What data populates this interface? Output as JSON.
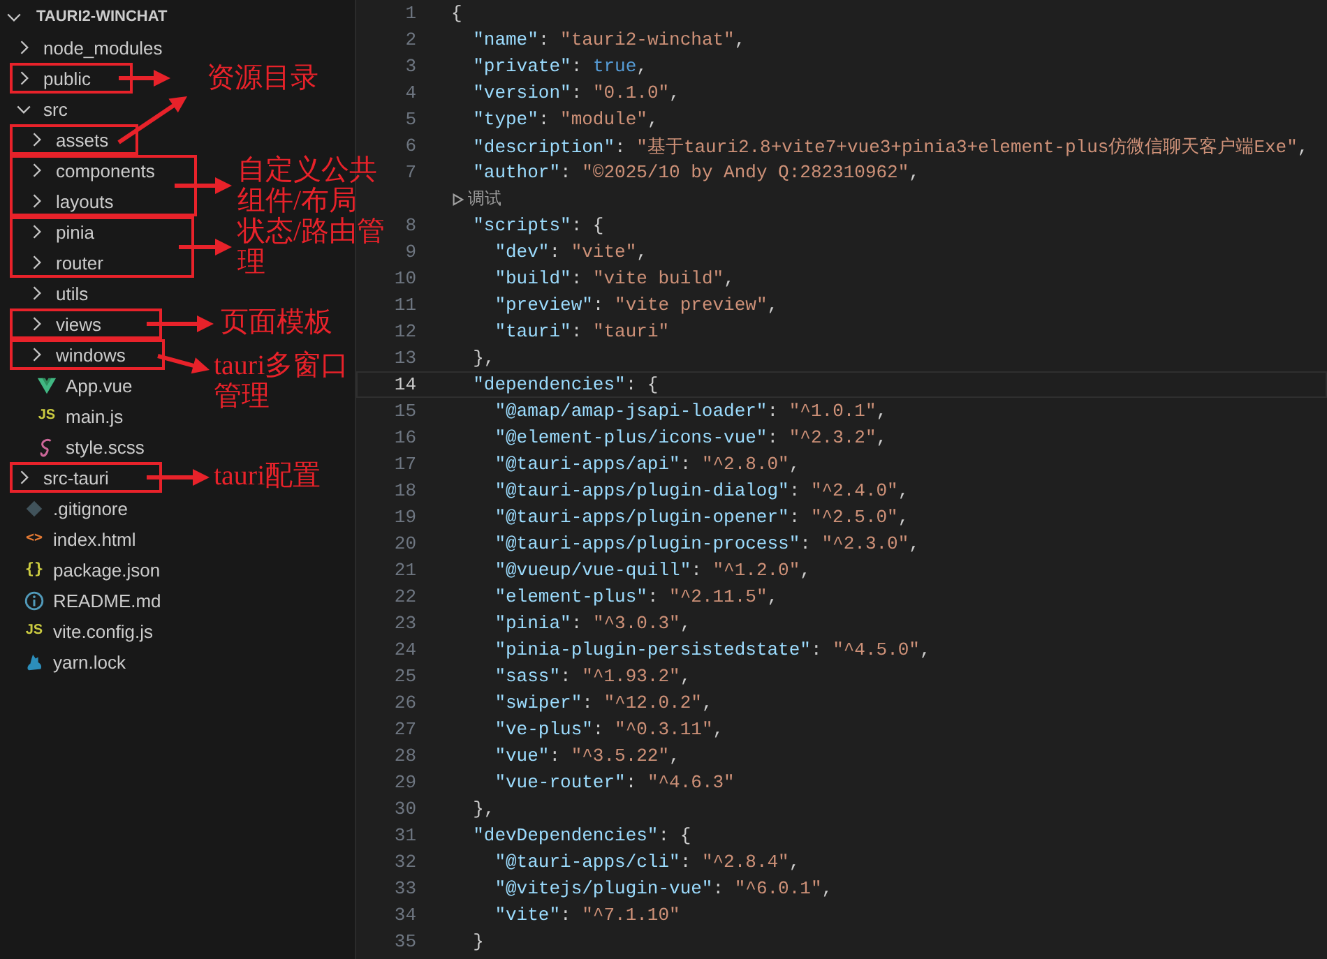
{
  "explorer": {
    "title": "TAURI2-WINCHAT",
    "expanded": true,
    "items": [
      {
        "label": "node_modules",
        "kind": "folder",
        "expanded": false
      },
      {
        "label": "public",
        "kind": "folder",
        "expanded": false
      },
      {
        "label": "src",
        "kind": "folder",
        "expanded": true,
        "children": [
          {
            "label": "assets",
            "kind": "folder",
            "expanded": false
          },
          {
            "label": "components",
            "kind": "folder",
            "expanded": false
          },
          {
            "label": "layouts",
            "kind": "folder",
            "expanded": false
          },
          {
            "label": "pinia",
            "kind": "folder",
            "expanded": false
          },
          {
            "label": "router",
            "kind": "folder",
            "expanded": false
          },
          {
            "label": "utils",
            "kind": "folder",
            "expanded": false
          },
          {
            "label": "views",
            "kind": "folder",
            "expanded": false
          },
          {
            "label": "windows",
            "kind": "folder",
            "expanded": false
          },
          {
            "label": "App.vue",
            "kind": "vue"
          },
          {
            "label": "main.js",
            "kind": "js",
            "glyph": "JS"
          },
          {
            "label": "style.scss",
            "kind": "scss"
          }
        ]
      },
      {
        "label": "src-tauri",
        "kind": "folder",
        "expanded": false
      },
      {
        "label": ".gitignore",
        "kind": "git"
      },
      {
        "label": "index.html",
        "kind": "html",
        "glyph": "<>"
      },
      {
        "label": "package.json",
        "kind": "json",
        "glyph": "{}"
      },
      {
        "label": "README.md",
        "kind": "info"
      },
      {
        "label": "vite.config.js",
        "kind": "js",
        "glyph": "JS"
      },
      {
        "label": "yarn.lock",
        "kind": "yarn"
      }
    ]
  },
  "editor": {
    "lines": [
      {
        "kind": "code",
        "number": "1",
        "selected": false,
        "tokens": [
          {
            "kind": "punct",
            "text": "{"
          }
        ]
      },
      {
        "kind": "code",
        "number": "2",
        "selected": false,
        "tokens": [
          {
            "kind": "key",
            "text": "  \"name\""
          },
          {
            "kind": "punct",
            "text": ": "
          },
          {
            "kind": "string",
            "text": "\"tauri2-winchat\""
          },
          {
            "kind": "punct",
            "text": ","
          }
        ]
      },
      {
        "kind": "code",
        "number": "3",
        "selected": false,
        "tokens": [
          {
            "kind": "key",
            "text": "  \"private\""
          },
          {
            "kind": "punct",
            "text": ": "
          },
          {
            "kind": "bool",
            "text": "true"
          },
          {
            "kind": "punct",
            "text": ","
          }
        ]
      },
      {
        "kind": "code",
        "number": "4",
        "selected": false,
        "tokens": [
          {
            "kind": "key",
            "text": "  \"version\""
          },
          {
            "kind": "punct",
            "text": ": "
          },
          {
            "kind": "string",
            "text": "\"0.1.0\""
          },
          {
            "kind": "punct",
            "text": ","
          }
        ]
      },
      {
        "kind": "code",
        "number": "5",
        "selected": false,
        "tokens": [
          {
            "kind": "key",
            "text": "  \"type\""
          },
          {
            "kind": "punct",
            "text": ": "
          },
          {
            "kind": "string",
            "text": "\"module\""
          },
          {
            "kind": "punct",
            "text": ","
          }
        ]
      },
      {
        "kind": "code",
        "number": "6",
        "selected": false,
        "tokens": [
          {
            "kind": "key",
            "text": "  \"description\""
          },
          {
            "kind": "punct",
            "text": ": "
          },
          {
            "kind": "string",
            "text": "\"基于tauri2.8+vite7+vue3+pinia3+element-plus仿微信聊天客户端Exe\""
          },
          {
            "kind": "punct",
            "text": ","
          }
        ]
      },
      {
        "kind": "code",
        "number": "7",
        "selected": false,
        "tokens": [
          {
            "kind": "key",
            "text": "  \"author\""
          },
          {
            "kind": "punct",
            "text": ": "
          },
          {
            "kind": "string",
            "text": "\"©2025/10 by Andy Q:282310962\""
          },
          {
            "kind": "punct",
            "text": ","
          }
        ]
      },
      {
        "kind": "codelens",
        "label": "调试"
      },
      {
        "kind": "code",
        "number": "8",
        "selected": false,
        "tokens": [
          {
            "kind": "key",
            "text": "  \"scripts\""
          },
          {
            "kind": "punct",
            "text": ": {"
          }
        ]
      },
      {
        "kind": "code",
        "number": "9",
        "selected": false,
        "tokens": [
          {
            "kind": "key",
            "text": "    \"dev\""
          },
          {
            "kind": "punct",
            "text": ": "
          },
          {
            "kind": "string",
            "text": "\"vite\""
          },
          {
            "kind": "punct",
            "text": ","
          }
        ]
      },
      {
        "kind": "code",
        "number": "10",
        "selected": false,
        "tokens": [
          {
            "kind": "key",
            "text": "    \"build\""
          },
          {
            "kind": "punct",
            "text": ": "
          },
          {
            "kind": "string",
            "text": "\"vite build\""
          },
          {
            "kind": "punct",
            "text": ","
          }
        ]
      },
      {
        "kind": "code",
        "number": "11",
        "selected": false,
        "tokens": [
          {
            "kind": "key",
            "text": "    \"preview\""
          },
          {
            "kind": "punct",
            "text": ": "
          },
          {
            "kind": "string",
            "text": "\"vite preview\""
          },
          {
            "kind": "punct",
            "text": ","
          }
        ]
      },
      {
        "kind": "code",
        "number": "12",
        "selected": false,
        "tokens": [
          {
            "kind": "key",
            "text": "    \"tauri\""
          },
          {
            "kind": "punct",
            "text": ": "
          },
          {
            "kind": "string",
            "text": "\"tauri\""
          }
        ]
      },
      {
        "kind": "code",
        "number": "13",
        "selected": false,
        "tokens": [
          {
            "kind": "punct",
            "text": "  },"
          }
        ]
      },
      {
        "kind": "code",
        "number": "14",
        "selected": true,
        "tokens": [
          {
            "kind": "key",
            "text": "  \"dependencies\""
          },
          {
            "kind": "punct",
            "text": ": {"
          }
        ]
      },
      {
        "kind": "code",
        "number": "15",
        "selected": false,
        "tokens": [
          {
            "kind": "key",
            "text": "    \"@amap/amap-jsapi-loader\""
          },
          {
            "kind": "punct",
            "text": ": "
          },
          {
            "kind": "string",
            "text": "\"^1.0.1\""
          },
          {
            "kind": "punct",
            "text": ","
          }
        ]
      },
      {
        "kind": "code",
        "number": "16",
        "selected": false,
        "tokens": [
          {
            "kind": "key",
            "text": "    \"@element-plus/icons-vue\""
          },
          {
            "kind": "punct",
            "text": ": "
          },
          {
            "kind": "string",
            "text": "\"^2.3.2\""
          },
          {
            "kind": "punct",
            "text": ","
          }
        ]
      },
      {
        "kind": "code",
        "number": "17",
        "selected": false,
        "tokens": [
          {
            "kind": "key",
            "text": "    \"@tauri-apps/api\""
          },
          {
            "kind": "punct",
            "text": ": "
          },
          {
            "kind": "string",
            "text": "\"^2.8.0\""
          },
          {
            "kind": "punct",
            "text": ","
          }
        ]
      },
      {
        "kind": "code",
        "number": "18",
        "selected": false,
        "tokens": [
          {
            "kind": "key",
            "text": "    \"@tauri-apps/plugin-dialog\""
          },
          {
            "kind": "punct",
            "text": ": "
          },
          {
            "kind": "string",
            "text": "\"^2.4.0\""
          },
          {
            "kind": "punct",
            "text": ","
          }
        ]
      },
      {
        "kind": "code",
        "number": "19",
        "selected": false,
        "tokens": [
          {
            "kind": "key",
            "text": "    \"@tauri-apps/plugin-opener\""
          },
          {
            "kind": "punct",
            "text": ": "
          },
          {
            "kind": "string",
            "text": "\"^2.5.0\""
          },
          {
            "kind": "punct",
            "text": ","
          }
        ]
      },
      {
        "kind": "code",
        "number": "20",
        "selected": false,
        "tokens": [
          {
            "kind": "key",
            "text": "    \"@tauri-apps/plugin-process\""
          },
          {
            "kind": "punct",
            "text": ": "
          },
          {
            "kind": "string",
            "text": "\"^2.3.0\""
          },
          {
            "kind": "punct",
            "text": ","
          }
        ]
      },
      {
        "kind": "code",
        "number": "21",
        "selected": false,
        "tokens": [
          {
            "kind": "key",
            "text": "    \"@vueup/vue-quill\""
          },
          {
            "kind": "punct",
            "text": ": "
          },
          {
            "kind": "string",
            "text": "\"^1.2.0\""
          },
          {
            "kind": "punct",
            "text": ","
          }
        ]
      },
      {
        "kind": "code",
        "number": "22",
        "selected": false,
        "tokens": [
          {
            "kind": "key",
            "text": "    \"element-plus\""
          },
          {
            "kind": "punct",
            "text": ": "
          },
          {
            "kind": "string",
            "text": "\"^2.11.5\""
          },
          {
            "kind": "punct",
            "text": ","
          }
        ]
      },
      {
        "kind": "code",
        "number": "23",
        "selected": false,
        "tokens": [
          {
            "kind": "key",
            "text": "    \"pinia\""
          },
          {
            "kind": "punct",
            "text": ": "
          },
          {
            "kind": "string",
            "text": "\"^3.0.3\""
          },
          {
            "kind": "punct",
            "text": ","
          }
        ]
      },
      {
        "kind": "code",
        "number": "24",
        "selected": false,
        "tokens": [
          {
            "kind": "key",
            "text": "    \"pinia-plugin-persistedstate\""
          },
          {
            "kind": "punct",
            "text": ": "
          },
          {
            "kind": "string",
            "text": "\"^4.5.0\""
          },
          {
            "kind": "punct",
            "text": ","
          }
        ]
      },
      {
        "kind": "code",
        "number": "25",
        "selected": false,
        "tokens": [
          {
            "kind": "key",
            "text": "    \"sass\""
          },
          {
            "kind": "punct",
            "text": ": "
          },
          {
            "kind": "string",
            "text": "\"^1.93.2\""
          },
          {
            "kind": "punct",
            "text": ","
          }
        ]
      },
      {
        "kind": "code",
        "number": "26",
        "selected": false,
        "tokens": [
          {
            "kind": "key",
            "text": "    \"swiper\""
          },
          {
            "kind": "punct",
            "text": ": "
          },
          {
            "kind": "string",
            "text": "\"^12.0.2\""
          },
          {
            "kind": "punct",
            "text": ","
          }
        ]
      },
      {
        "kind": "code",
        "number": "27",
        "selected": false,
        "tokens": [
          {
            "kind": "key",
            "text": "    \"ve-plus\""
          },
          {
            "kind": "punct",
            "text": ": "
          },
          {
            "kind": "string",
            "text": "\"^0.3.11\""
          },
          {
            "kind": "punct",
            "text": ","
          }
        ]
      },
      {
        "kind": "code",
        "number": "28",
        "selected": false,
        "tokens": [
          {
            "kind": "key",
            "text": "    \"vue\""
          },
          {
            "kind": "punct",
            "text": ": "
          },
          {
            "kind": "string",
            "text": "\"^3.5.22\""
          },
          {
            "kind": "punct",
            "text": ","
          }
        ]
      },
      {
        "kind": "code",
        "number": "29",
        "selected": false,
        "tokens": [
          {
            "kind": "key",
            "text": "    \"vue-router\""
          },
          {
            "kind": "punct",
            "text": ": "
          },
          {
            "kind": "string",
            "text": "\"^4.6.3\""
          }
        ]
      },
      {
        "kind": "code",
        "number": "30",
        "selected": false,
        "tokens": [
          {
            "kind": "punct",
            "text": "  },"
          }
        ]
      },
      {
        "kind": "code",
        "number": "31",
        "selected": false,
        "tokens": [
          {
            "kind": "key",
            "text": "  \"devDependencies\""
          },
          {
            "kind": "punct",
            "text": ": {"
          }
        ]
      },
      {
        "kind": "code",
        "number": "32",
        "selected": false,
        "tokens": [
          {
            "kind": "key",
            "text": "    \"@tauri-apps/cli\""
          },
          {
            "kind": "punct",
            "text": ": "
          },
          {
            "kind": "string",
            "text": "\"^2.8.4\""
          },
          {
            "kind": "punct",
            "text": ","
          }
        ]
      },
      {
        "kind": "code",
        "number": "33",
        "selected": false,
        "tokens": [
          {
            "kind": "key",
            "text": "    \"@vitejs/plugin-vue\""
          },
          {
            "kind": "punct",
            "text": ": "
          },
          {
            "kind": "string",
            "text": "\"^6.0.1\""
          },
          {
            "kind": "punct",
            "text": ","
          }
        ]
      },
      {
        "kind": "code",
        "number": "34",
        "selected": false,
        "tokens": [
          {
            "kind": "key",
            "text": "    \"vite\""
          },
          {
            "kind": "punct",
            "text": ": "
          },
          {
            "kind": "string",
            "text": "\"^7.1.10\""
          }
        ]
      },
      {
        "kind": "code",
        "number": "35",
        "selected": false,
        "tokens": [
          {
            "kind": "punct",
            "text": "  }"
          }
        ]
      }
    ]
  },
  "annotations": [
    {
      "label": "资源目录"
    },
    {
      "label": "自定义公共组件/布局"
    },
    {
      "label": "状态/路由管理"
    },
    {
      "label": "页面模板"
    },
    {
      "label": "tauri多窗口管理"
    },
    {
      "label": "tauri配置"
    }
  ]
}
